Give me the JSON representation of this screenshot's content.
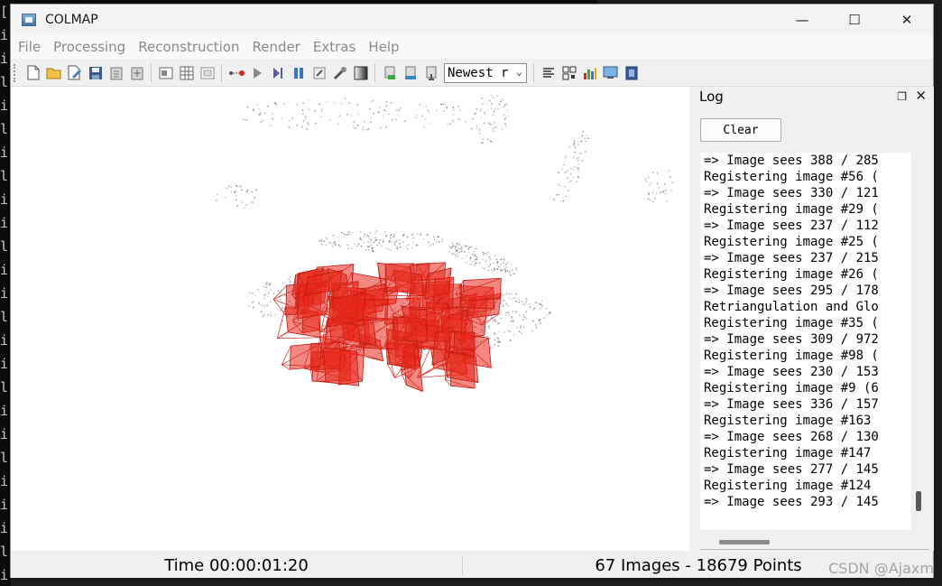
{
  "terminal": {
    "lines": [
      "[",
      "i",
      "i",
      "l",
      "i",
      "l",
      "i",
      "l",
      "i",
      "i",
      "l",
      "i",
      "i",
      "l",
      "i",
      "i",
      "l",
      "i",
      "i",
      "l",
      "i",
      "i",
      "i",
      "l",
      "i"
    ]
  },
  "window": {
    "title": "COLMAP",
    "minimize_symbol": "—",
    "maximize_symbol": "☐",
    "close_symbol": "✕"
  },
  "menu": {
    "items": [
      "File",
      "Processing",
      "Reconstruction",
      "Render",
      "Extras",
      "Help"
    ]
  },
  "toolbar": {
    "group1": [
      "new-project-icon",
      "open-project-icon",
      "edit-project-icon",
      "save-icon",
      "import-icon",
      "export-icon"
    ],
    "group2": [
      "feature-extraction-icon",
      "feature-matching-icon",
      "database-icon"
    ],
    "group3": [
      "automatic-reconstruction-icon",
      "start-icon",
      "step-icon",
      "pause-icon",
      "settings-icon",
      "bundle-adjustment-icon"
    ],
    "group4": [
      "dense-reconstruction-icon",
      "render-options-icon",
      "reconstruction-stats-icon"
    ],
    "reconstruction_select": "Newest r",
    "group5": [
      "log-icon",
      "match-matrix-icon",
      "statistics-icon",
      "screenshot-icon",
      "movie-icon"
    ]
  },
  "log": {
    "title": "Log",
    "float_symbol": "❐",
    "close_symbol": "✕",
    "clear_label": "Clear",
    "lines": [
      "=> Image sees 388 / 285",
      "Registering image #56 (",
      "=> Image sees 330 / 121",
      "Registering image #29 (",
      "=> Image sees 237 / 112",
      "Registering image #25 (",
      "=> Image sees 237 / 215",
      "Registering image #26 (",
      "=> Image sees 295 / 178",
      "Retriangulation and Glo",
      "Registering image #35 (",
      "=> Image sees 309 / 972",
      "Registering image #98 (",
      "=> Image sees 230 / 153",
      "Registering image #9 (6",
      "=> Image sees 336 / 157",
      "Registering image #163",
      "=> Image sees 268 / 130",
      "Registering image #147",
      "=> Image sees 277 / 145",
      "Registering image #124",
      "=> Image sees 293 / 145"
    ]
  },
  "status": {
    "time": "Time 00:00:01:20",
    "counts": "67 Images - 18679 Points"
  },
  "watermark": "CSDN @Ajaxm",
  "colors": {
    "camera_red": "#e8261a",
    "point_gray": "#6f6f6f"
  }
}
